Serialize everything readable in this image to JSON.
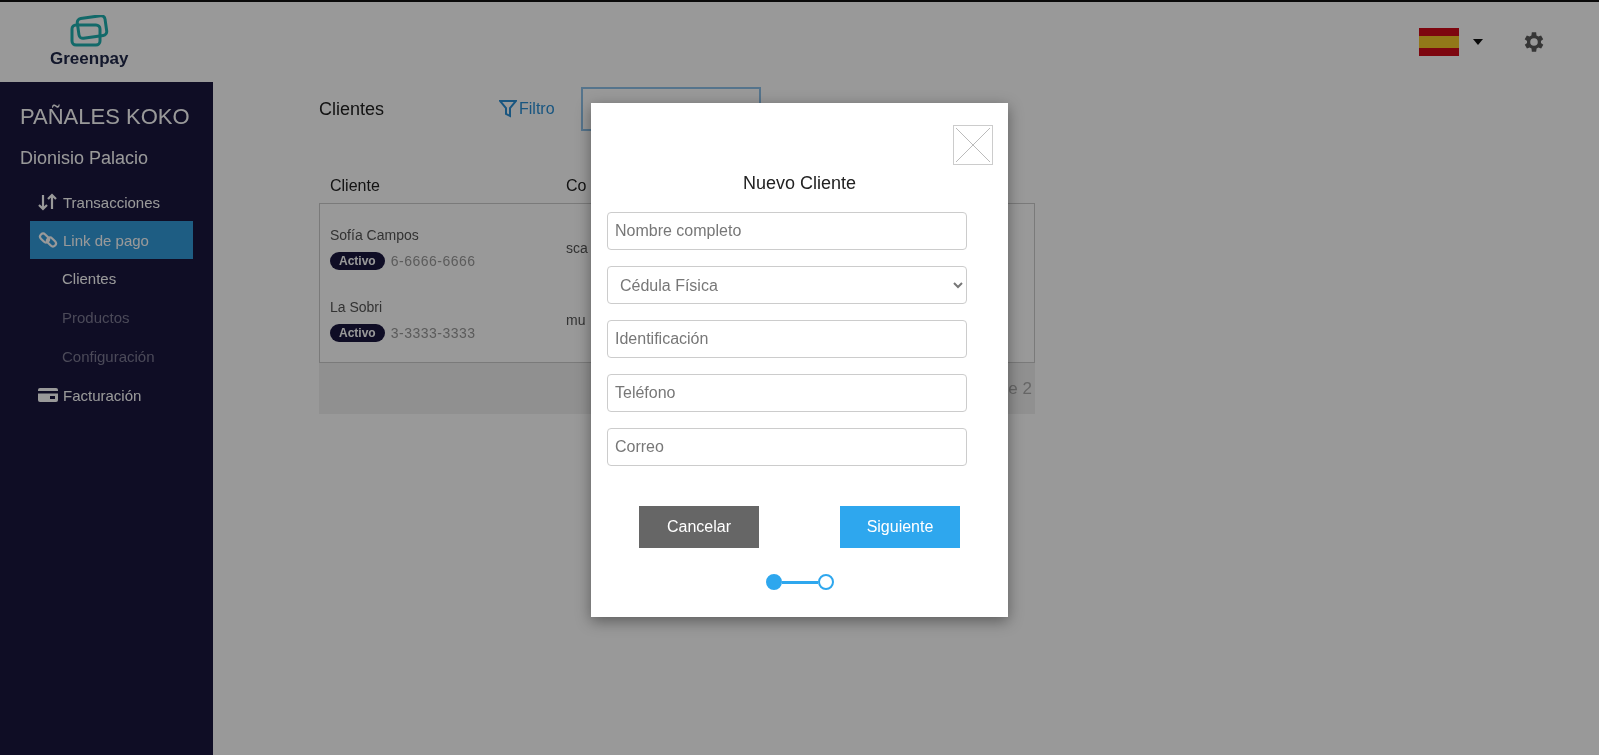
{
  "header": {
    "logo_text": "Greenpay"
  },
  "sidebar": {
    "company": "PAÑALES KOKO",
    "user": "Dionisio Palacio",
    "items": [
      {
        "label": "Transacciones",
        "kind": "arrows",
        "selected": false
      },
      {
        "label": "Link de pago",
        "kind": "link",
        "selected": true,
        "children": [
          {
            "label": "Clientes",
            "selected": true
          },
          {
            "label": "Productos",
            "selected": false
          },
          {
            "label": "Configuración",
            "selected": false
          }
        ]
      },
      {
        "label": "Facturación",
        "kind": "card",
        "selected": false
      }
    ]
  },
  "page": {
    "title": "Clientes",
    "filter_label": "Filtro"
  },
  "table": {
    "columns": [
      "Cliente",
      "Co"
    ],
    "rows": [
      {
        "name": "Sofía Campos",
        "status": "Activo",
        "phone": "6-6666-6666",
        "column_2": "sca"
      },
      {
        "name": "La Sobri",
        "status": "Activo",
        "phone": "3-3333-3333",
        "column_2": "mu"
      }
    ],
    "pagination": "e 2"
  },
  "modal": {
    "title": "Nuevo Cliente",
    "fields": [
      {
        "kind": "input",
        "placeholder": "Nombre completo"
      },
      {
        "kind": "select",
        "value": "Cédula Física"
      },
      {
        "kind": "input",
        "placeholder": "Identificación"
      },
      {
        "kind": "input",
        "placeholder": "Teléfono"
      },
      {
        "kind": "input",
        "placeholder": "Correo"
      }
    ],
    "buttons": [
      {
        "label": "Cancelar",
        "kind": "secondary"
      },
      {
        "label": "Siguiente",
        "kind": "primary"
      }
    ],
    "steps": [
      {
        "selected": true
      },
      {
        "selected": false
      }
    ]
  }
}
